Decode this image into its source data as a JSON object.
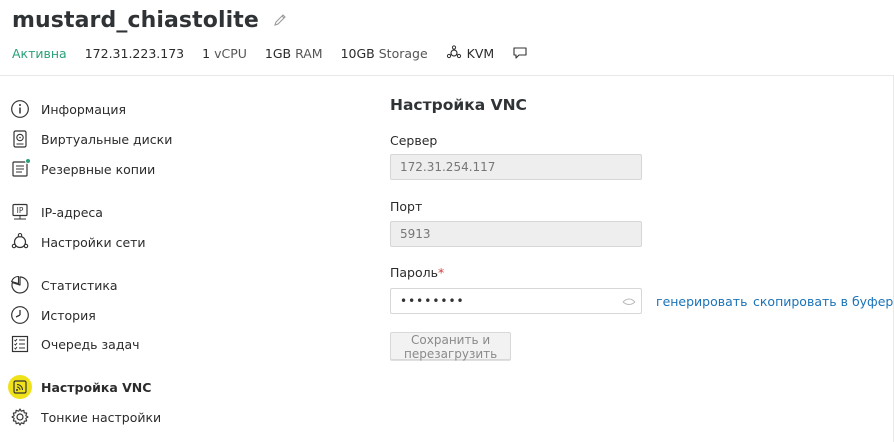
{
  "server": {
    "name": "mustard_chiastolite",
    "status": "Активна",
    "ip": "172.31.223.173",
    "cpu_value": "1",
    "cpu_unit": "vCPU",
    "ram_value": "1GB",
    "ram_unit": "RAM",
    "storage_value": "10GB",
    "storage_unit": "Storage",
    "hypervisor": "KVM"
  },
  "sidebar": {
    "items": [
      {
        "label": "Информация",
        "icon": "info-icon"
      },
      {
        "label": "Виртуальные диски",
        "icon": "disk-icon"
      },
      {
        "label": "Резервные копии",
        "icon": "backup-icon"
      },
      {
        "label": "IP-адреса",
        "icon": "ip-icon"
      },
      {
        "label": "Настройки сети",
        "icon": "network-icon"
      },
      {
        "label": "Статистика",
        "icon": "stats-icon"
      },
      {
        "label": "История",
        "icon": "history-icon"
      },
      {
        "label": "Очередь задач",
        "icon": "tasks-icon"
      },
      {
        "label": "Настройка VNC",
        "icon": "vnc-icon"
      },
      {
        "label": "Тонкие настройки",
        "icon": "gear-icon"
      }
    ]
  },
  "vnc": {
    "title": "Настройка VNC",
    "server_label": "Сервер",
    "server_value": "172.31.254.117",
    "port_label": "Порт",
    "port_value": "5913",
    "password_label": "Пароль",
    "required_mark": "*",
    "password_value": "••••••••",
    "generate_link": "генерировать",
    "copy_link": "скопировать в буфер",
    "save_button": "Сохранить и перезагрузить"
  },
  "colors": {
    "status_active": "#2aa176",
    "link": "#1a73b8",
    "active_highlight": "#f0e21a",
    "required": "#d43c3c"
  }
}
